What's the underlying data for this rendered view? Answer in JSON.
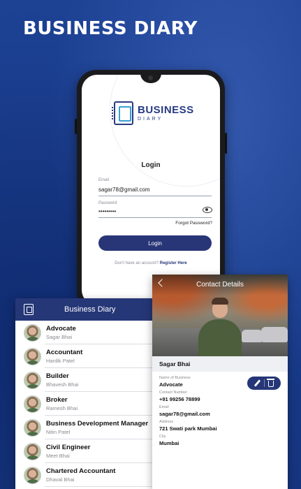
{
  "banner": {
    "title": "BUSINESS DIARY"
  },
  "login_screen": {
    "logo_primary": "BUSINESS",
    "logo_secondary": "DIARY",
    "title": "Login",
    "email_label": "Email",
    "email_value": "sagar78@gmail.com",
    "password_label": "Password",
    "password_value": "•••••••••",
    "forgot_label": "Forgot Password?",
    "login_button": "Login",
    "register_prompt": "Don't have an account?",
    "register_link": "Register Here"
  },
  "list_screen": {
    "title": "Business Diary",
    "items": [
      {
        "title": "Advocate",
        "subtitle": "Sagar Bhai"
      },
      {
        "title": "Accountant",
        "subtitle": "Hardik Patel"
      },
      {
        "title": "Builder",
        "subtitle": "Bhavesh Bhai"
      },
      {
        "title": "Broker",
        "subtitle": "Ramesh Bhai"
      },
      {
        "title": "Business Development Manager",
        "subtitle": "Nitin Patel"
      },
      {
        "title": "Civil Engineer",
        "subtitle": "Meet Bhai"
      },
      {
        "title": "Chartered Accountant",
        "subtitle": "Dhaval Bhai"
      }
    ]
  },
  "contact_screen": {
    "title": "Contact Details",
    "name": "Sagar Bhai",
    "business_label": "Name of Business",
    "business_value": "Advocate",
    "phone_label": "Contact Number",
    "phone_value": "+91 99256 78899",
    "email_label": "Email",
    "email_value": "sagar78@gmail.com",
    "address_label": "Address",
    "address_value": "721 Swati park Mumbai",
    "city_label": "City",
    "city_value": "Mumbai"
  },
  "colors": {
    "primary": "#263778",
    "background": "#1a3d8f"
  }
}
